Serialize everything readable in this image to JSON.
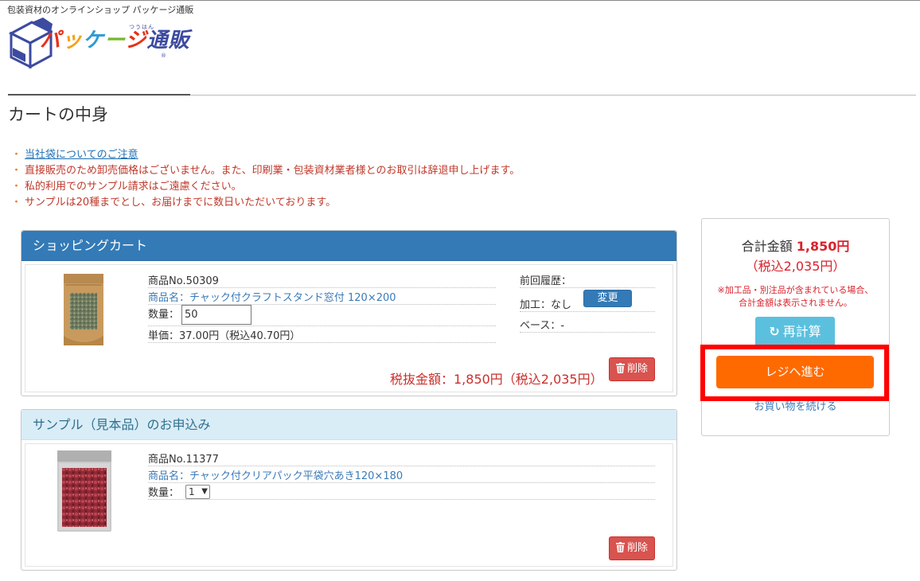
{
  "header": {
    "tagline": "包装資材のオンラインショップ パッケージ通販",
    "logo_text": "パッケージ通販",
    "logo_ruby": "つうはん",
    "logo_reg": "®"
  },
  "page_title": "カートの中身",
  "notices": [
    {
      "text": "当社袋についてのご注意",
      "link": true
    },
    {
      "text": "直接販売のため卸売価格はございません。また、印刷業・包装資材業者様とのお取引は辞退申し上げます。",
      "link": false
    },
    {
      "text": "私的利用でのサンプル請求はご遠慮ください。",
      "link": false
    },
    {
      "text": "サンプルは20種までとし、お届けまでに数日いただいております。",
      "link": false
    }
  ],
  "cart": {
    "heading": "ショッピングカート",
    "item": {
      "product_no": "商品No.50309",
      "product_name": "商品名：チャック付クラフトスタンド窓付 120×200",
      "quantity_label": "数量：",
      "quantity_value": "50",
      "unit_price": "単価：37.00円（税込40.70円）",
      "history_label": "前回履歴：",
      "processing": "加工：なし",
      "change_label": "変更",
      "base": "ベース：-",
      "subtotal": "税抜金額：1,850円（税込2,035円）",
      "delete_label": "削除"
    }
  },
  "sample": {
    "heading": "サンプル（見本品）のお申込み",
    "item": {
      "product_no": "商品No.11377",
      "product_name": "商品名：チャック付クリアパック平袋穴あき120×180",
      "quantity_label": "数量：",
      "quantity_selected": "1",
      "delete_label": "削除"
    }
  },
  "summary": {
    "total_label": "合計金額",
    "total_amount": "1,850円",
    "tax_included": "（税込2,035円）",
    "note": "※加工品・別注品が含まれている場合、合計金額は表示されません。",
    "recalc_label": "再計算",
    "checkout_label": "レジへ進む",
    "continue_label": "お買い物を続ける"
  },
  "colors": {
    "primary": "#337ab7",
    "danger": "#d9534f",
    "accent_orange": "#ff6a00",
    "info": "#5bc0de",
    "highlight_frame": "#ff0000"
  }
}
